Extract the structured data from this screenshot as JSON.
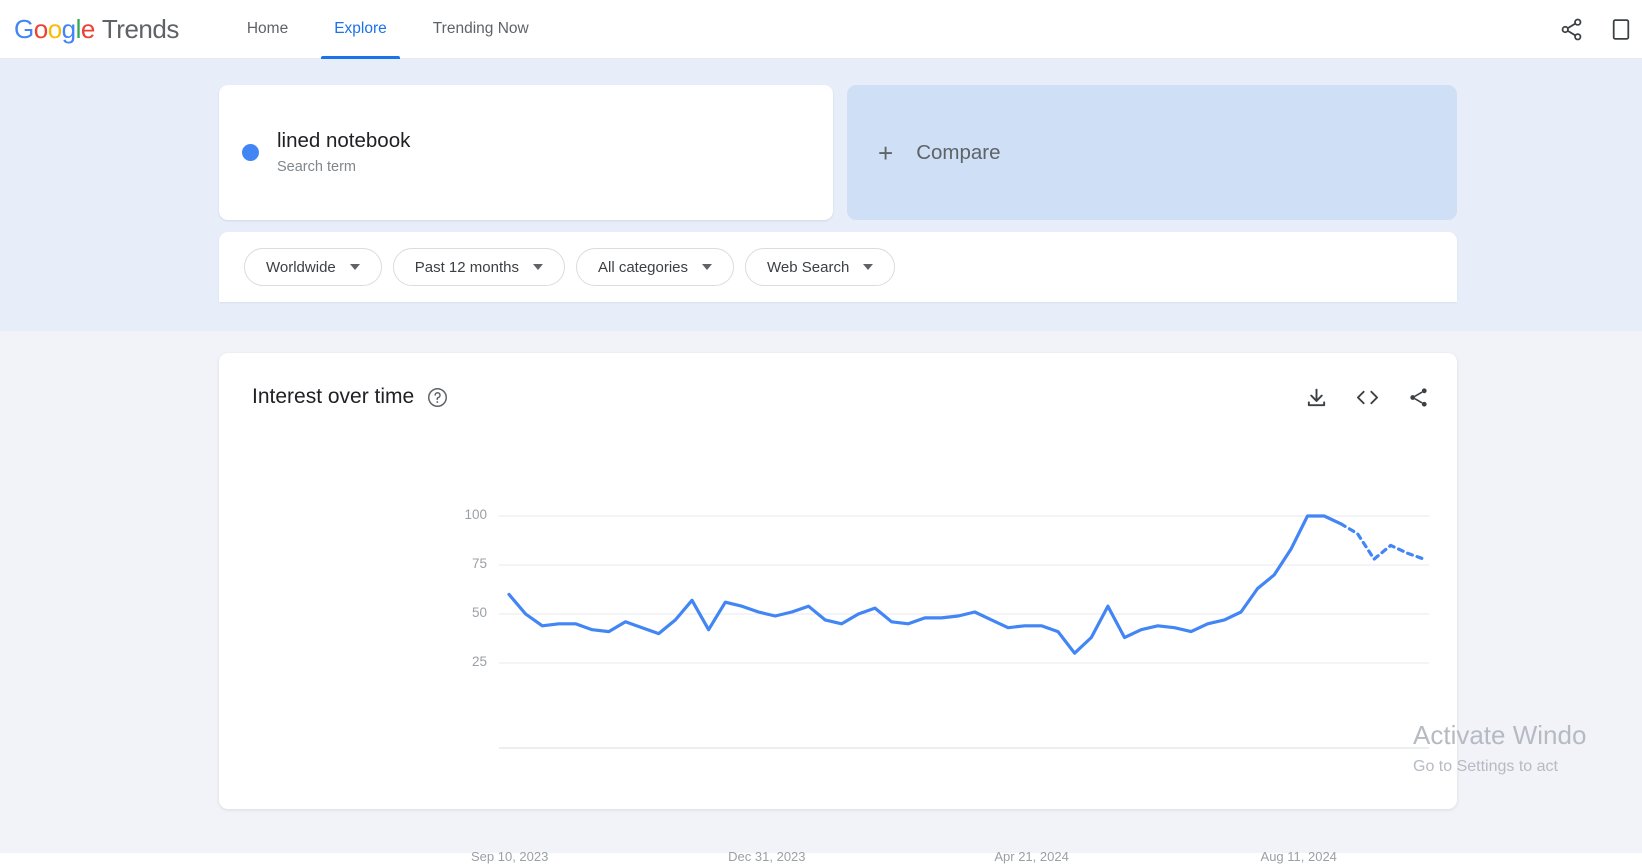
{
  "header": {
    "logo": {
      "word": "Google",
      "letters": [
        "G",
        "o",
        "o",
        "g",
        "l",
        "e"
      ],
      "colors": [
        "#4285f4",
        "#ea4335",
        "#fbbc05",
        "#4285f4",
        "#34a853",
        "#ea4335"
      ],
      "product": "Trends"
    },
    "nav": [
      {
        "label": "Home",
        "active": false
      },
      {
        "label": "Explore",
        "active": true
      },
      {
        "label": "Trending Now",
        "active": false
      }
    ],
    "icons": [
      "share-icon",
      "overflow-icon"
    ]
  },
  "query": {
    "term": "lined notebook",
    "term_type": "Search term",
    "term_color": "#4285f4",
    "compare_label": "Compare",
    "compare_plus": "+"
  },
  "filters": [
    {
      "label": "Worldwide"
    },
    {
      "label": "Past 12 months"
    },
    {
      "label": "All categories"
    },
    {
      "label": "Web Search"
    }
  ],
  "chart_card": {
    "title": "Interest over time",
    "help_icon": "help-circle-icon",
    "actions": [
      "download-icon",
      "embed-code-icon",
      "share-icon"
    ]
  },
  "watermark": {
    "title": "Activate Windo",
    "subtitle": "Go to Settings to act"
  },
  "chart_data": {
    "type": "line",
    "title": "Interest over time",
    "xlabel": "",
    "ylabel": "",
    "ylim": [
      0,
      105
    ],
    "yticks": [
      25,
      50,
      75,
      100
    ],
    "grid": true,
    "legend": false,
    "line_color": "#4285f4",
    "xtick_labels": [
      "Sep 10, 2023",
      "Dec 31, 2023",
      "Apr 21, 2024",
      "Aug 11, 2024"
    ],
    "xtick_positions": [
      0,
      16,
      32,
      48
    ],
    "partial_from_index": 50,
    "series": [
      {
        "name": "lined notebook",
        "color": "#4285f4",
        "values": [
          60,
          50,
          44,
          45,
          45,
          42,
          41,
          46,
          43,
          40,
          47,
          57,
          42,
          56,
          54,
          51,
          49,
          51,
          54,
          47,
          45,
          50,
          53,
          46,
          45,
          48,
          48,
          49,
          51,
          47,
          43,
          44,
          44,
          41,
          30,
          38,
          54,
          38,
          42,
          44,
          43,
          41,
          45,
          47,
          51,
          63,
          70,
          83,
          100,
          100,
          96,
          91,
          78,
          85,
          81,
          78
        ]
      }
    ]
  }
}
